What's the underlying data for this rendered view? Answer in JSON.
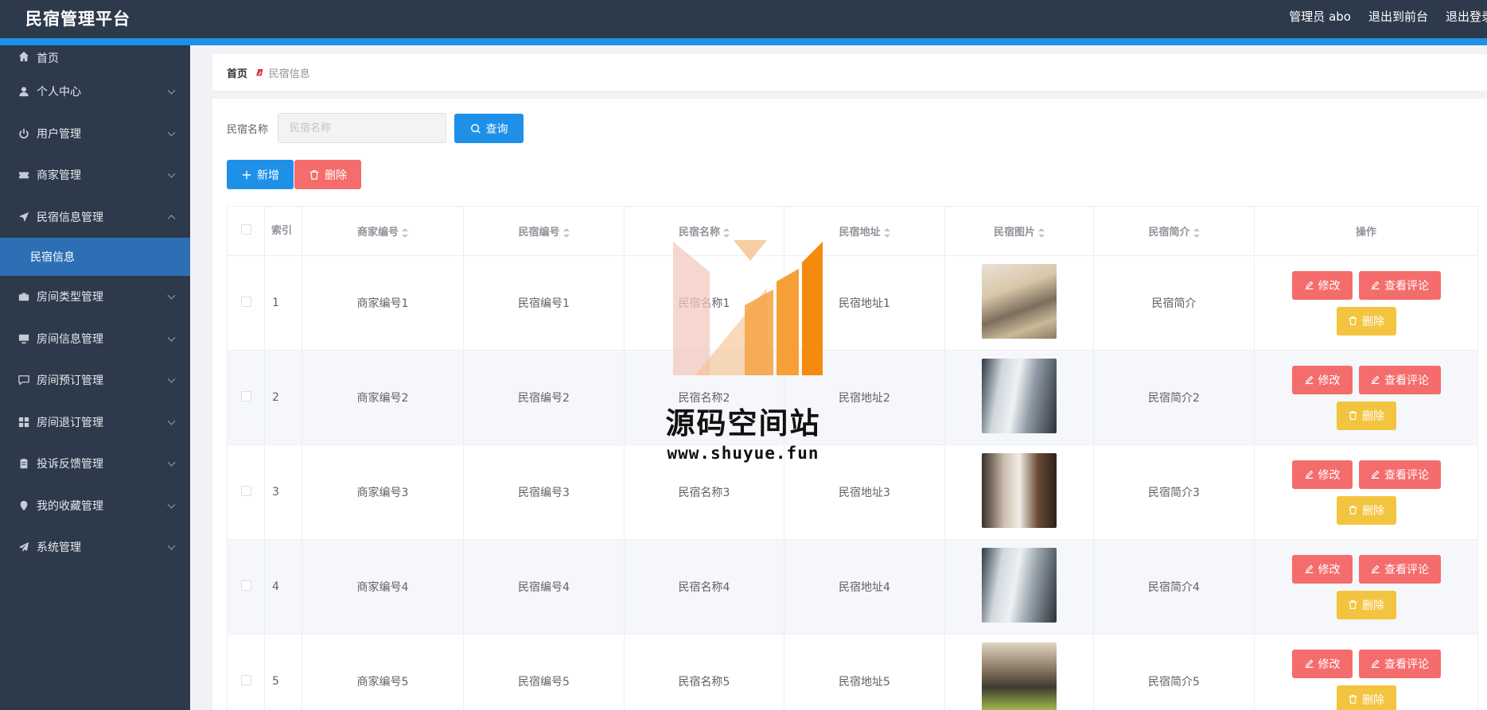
{
  "app": {
    "title": "民宿管理平台",
    "admin_label": "管理员 abo",
    "to_front": "退出到前台",
    "logout": "退出登录"
  },
  "sidebar": {
    "items": [
      {
        "label": "首页",
        "icon": "home-icon"
      },
      {
        "label": "个人中心",
        "icon": "user-icon"
      },
      {
        "label": "用户管理",
        "icon": "power-icon"
      },
      {
        "label": "商家管理",
        "icon": "ticket-icon"
      },
      {
        "label": "民宿信息管理",
        "icon": "navigation-icon"
      },
      {
        "label": "民宿信息",
        "icon": ""
      },
      {
        "label": "房间类型管理",
        "icon": "briefcase-icon"
      },
      {
        "label": "房间信息管理",
        "icon": "monitor-icon"
      },
      {
        "label": "房间预订管理",
        "icon": "chat-icon"
      },
      {
        "label": "房间退订管理",
        "icon": "grid-icon"
      },
      {
        "label": "投诉反馈管理",
        "icon": "clipboard-icon"
      },
      {
        "label": "我的收藏管理",
        "icon": "map-pin-icon"
      },
      {
        "label": "系统管理",
        "icon": "send-icon"
      }
    ]
  },
  "breadcrumb": {
    "home": "首页",
    "separator": "ฮ",
    "current": "民宿信息"
  },
  "search": {
    "label": "民宿名称",
    "placeholder": "民宿名称",
    "query_button": "查询"
  },
  "toolbar": {
    "add_label": "新增",
    "delete_label": "删除"
  },
  "table": {
    "headers": [
      "索引",
      "商家编号",
      "民宿编号",
      "民宿名称",
      "民宿地址",
      "民宿图片",
      "民宿简介",
      "操作"
    ],
    "rows": [
      {
        "index": "1",
        "merchant": "商家编号1",
        "homestay_no": "民宿编号1",
        "name": "民宿名称1",
        "address": "民宿地址1",
        "intro": "民宿简介"
      },
      {
        "index": "2",
        "merchant": "商家编号2",
        "homestay_no": "民宿编号2",
        "name": "民宿名称2",
        "address": "民宿地址2",
        "intro": "民宿简介2"
      },
      {
        "index": "3",
        "merchant": "商家编号3",
        "homestay_no": "民宿编号3",
        "name": "民宿名称3",
        "address": "民宿地址3",
        "intro": "民宿简介3"
      },
      {
        "index": "4",
        "merchant": "商家编号4",
        "homestay_no": "民宿编号4",
        "name": "民宿名称4",
        "address": "民宿地址4",
        "intro": "民宿简介4"
      },
      {
        "index": "5",
        "merchant": "商家编号5",
        "homestay_no": "民宿编号5",
        "name": "民宿名称5",
        "address": "民宿地址5",
        "intro": "民宿简介5"
      }
    ],
    "actions": {
      "edit": "修改",
      "view_comments": "查看评论",
      "delete": "删除"
    }
  },
  "watermark": {
    "title": "源码空间站",
    "url": "www.shuyue.fun"
  },
  "colors": {
    "header_bg": "#2d3a4b",
    "accent": "#1e90e8",
    "danger": "#f56c6c",
    "warning": "#f3c43f",
    "sidebar_active": "#2d6fb4"
  }
}
